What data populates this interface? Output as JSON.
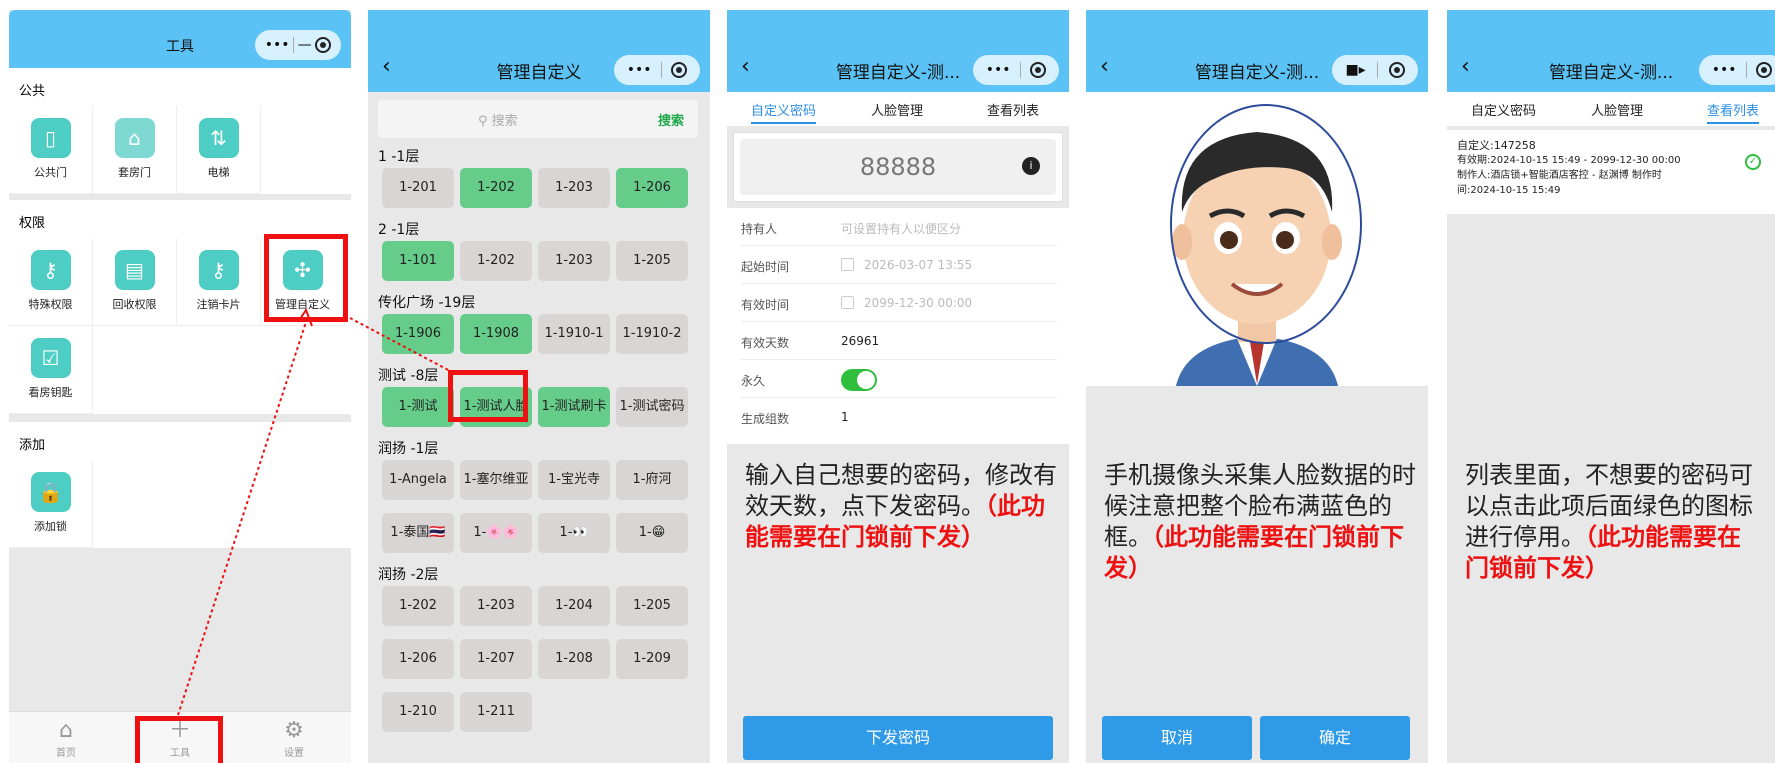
{
  "panel1": {
    "title": "工具",
    "capsule_dots": "•••",
    "capsule_minus": "—",
    "section_public": "公共",
    "public_items": [
      {
        "label": "公共门",
        "icon": "door-icon"
      },
      {
        "label": "套房门",
        "icon": "house-icon"
      },
      {
        "label": "电梯",
        "icon": "elevator-icon"
      }
    ],
    "section_perm": "权限",
    "perm_items": [
      {
        "label": "特殊权限",
        "icon": "key-user-icon"
      },
      {
        "label": "回收权限",
        "icon": "card-recycle-icon"
      },
      {
        "label": "注销卡片",
        "icon": "key-minus-icon"
      },
      {
        "label": "管理自定义",
        "icon": "puzzle-icon"
      },
      {
        "label": "看房钥匙",
        "icon": "calendar-check-icon"
      }
    ],
    "section_add": "添加",
    "add_items": [
      {
        "label": "添加锁",
        "icon": "lock-add-icon"
      }
    ],
    "tabs": [
      {
        "label": "首页",
        "icon": "home-icon"
      },
      {
        "label": "工具",
        "icon": "plus-icon"
      },
      {
        "label": "设置",
        "icon": "gear-icon"
      }
    ]
  },
  "panel2": {
    "title": "管理自定义",
    "search_placeholder": "搜索",
    "search_button": "搜索",
    "floors": [
      {
        "name": "1 -1层",
        "rooms": [
          "1-201",
          "1-202",
          "1-203",
          "1-206"
        ]
      },
      {
        "name": "2 -1层",
        "rooms": [
          "1-101",
          "1-202",
          "1-203",
          "1-205"
        ]
      },
      {
        "name": "传化广场 -19层",
        "rooms": [
          "1-1906",
          "1-1908",
          "1-1910-1",
          "1-1910-2"
        ]
      },
      {
        "name": "测试 -8层",
        "rooms": [
          "1-测试",
          "1-测试人脸",
          "1-测试刷卡",
          "1-测试密码"
        ]
      },
      {
        "name": "润扬 -1层",
        "rooms": [
          "1-Angela",
          "1-塞尔维亚",
          "1-宝光寺",
          "1-府河",
          "1-泰国🇹🇭",
          "1-🌸🌸",
          "1-👀",
          "1-😁"
        ]
      },
      {
        "name": "润扬 -2层",
        "rooms": [
          "1-202",
          "1-203",
          "1-204",
          "1-205",
          "1-206",
          "1-207",
          "1-208",
          "1-209",
          "1-210",
          "1-211"
        ]
      }
    ]
  },
  "panel3": {
    "title": "管理自定义-测...",
    "tabs": [
      "自定义密码",
      "人脸管理",
      "查看列表"
    ],
    "password": "88888",
    "fields": {
      "holder_label": "持有人",
      "holder_placeholder": "可设置持有人以便区分",
      "start_label": "起始时间",
      "start_value": "2026-03-07 13:55",
      "valid_label": "有效时间",
      "valid_value": "2099-12-30 00:00",
      "days_label": "有效天数",
      "days_value": "26961",
      "forever_label": "永久",
      "groups_label": "生成组数",
      "groups_value": "1"
    },
    "desc": "输入自己想要的密码，修改有效天数，点下发密码。",
    "desc_red": "（此功能需要在门锁前下发）",
    "submit": "下发密码"
  },
  "panel4": {
    "title": "管理自定义-测...",
    "desc": "手机摄像头采集人脸数据的时候注意把整个脸布满蓝色的框。",
    "desc_red": "（此功能需要在门锁前下发）",
    "cancel": "取消",
    "confirm": "确定"
  },
  "panel5": {
    "title": "管理自定义-测...",
    "tabs": [
      "自定义密码",
      "人脸管理",
      "查看列表"
    ],
    "item_name": "自定义:147258",
    "item_validity": "有效期:2024-10-15 15:49 - 2099-12-30 00:00",
    "item_maker": "制作人:酒店锁+智能酒店客控 - 赵渊博    制作时",
    "item_time": "间:2024-10-15 15:49",
    "desc": "列表里面，不想要的密码可以点击此项后面绿色的图标进行停用。",
    "desc_red": "（此功能需要在门锁前下发）"
  }
}
